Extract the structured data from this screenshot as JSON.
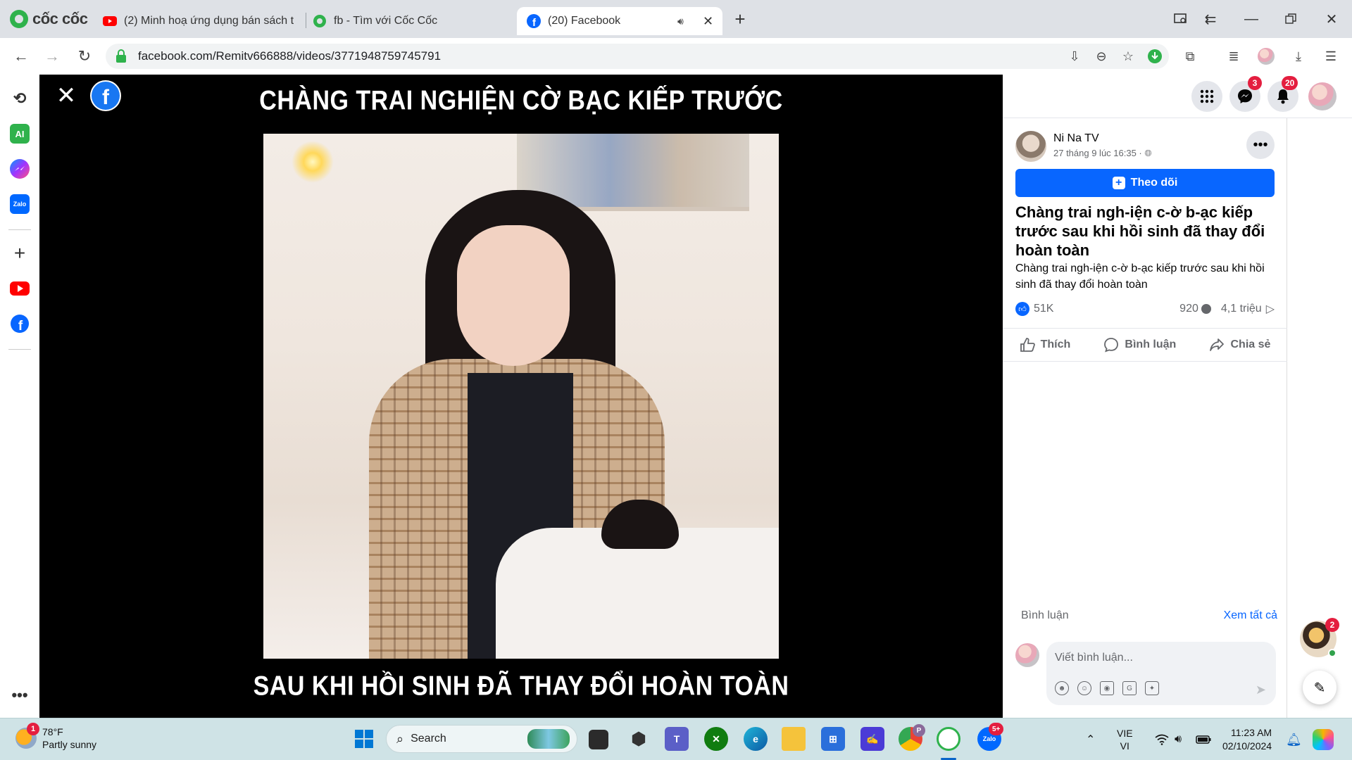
{
  "browser": {
    "brand": "cốc cốc",
    "tabs": [
      {
        "label": "(2) Minh hoạ ứng dụng bán sách t",
        "icon": "youtube-icon"
      },
      {
        "label": "fb - Tìm với Cốc Cốc",
        "icon": "coccoc-icon"
      },
      {
        "label": "(20) Facebook",
        "icon": "facebook-icon",
        "active": true
      }
    ],
    "url": "facebook.com/Remitv666888/videos/3771948759745791"
  },
  "sidebar": {
    "ai_label": "AI",
    "zalo_label": "Zalo"
  },
  "video": {
    "caption_top": "CHÀNG TRAI NGHIỆN CỜ BẠC KIẾP TRƯỚC",
    "caption_bottom": "SAU KHI HỒI SINH ĐÃ THAY ĐỔI HOÀN TOÀN"
  },
  "header": {
    "messenger_badge": "3",
    "notifications_badge": "20"
  },
  "post": {
    "author": "Ni Na TV",
    "meta": "27 tháng 9 lúc 16:35 · ",
    "follow_label": "Theo dõi",
    "title": "Chàng trai ngh-iện c-ờ b-ạc kiếp trước sau khi hồi sinh đã thay đổi hoàn toàn",
    "description": "Chàng trai ngh-iện c-ờ b-ạc kiếp trước sau khi hồi sinh đã thay đổi hoàn toàn",
    "reactions": "51K",
    "comments_count": "920",
    "views": "4,1 triệu",
    "actions": {
      "like": "Thích",
      "comment": "Bình luận",
      "share": "Chia sẻ"
    },
    "comments_label": "Bình luận",
    "see_all": "Xem tất cả",
    "comment_placeholder": "Viết bình luận..."
  },
  "float_chat_badge": "2",
  "taskbar": {
    "weather_temp": "78°F",
    "weather_desc": "Partly sunny",
    "weather_badge": "1",
    "search_label": "Search",
    "chrome_badge": "P",
    "zalo_badge": "5+",
    "lang_top": "VIE",
    "lang_bottom": "VI",
    "time": "11:23 AM",
    "date": "02/10/2024"
  },
  "colors": {
    "facebook_blue": "#0866ff",
    "badge_red": "#e41e3f",
    "taskbar_bg": "#cfe3e6"
  }
}
